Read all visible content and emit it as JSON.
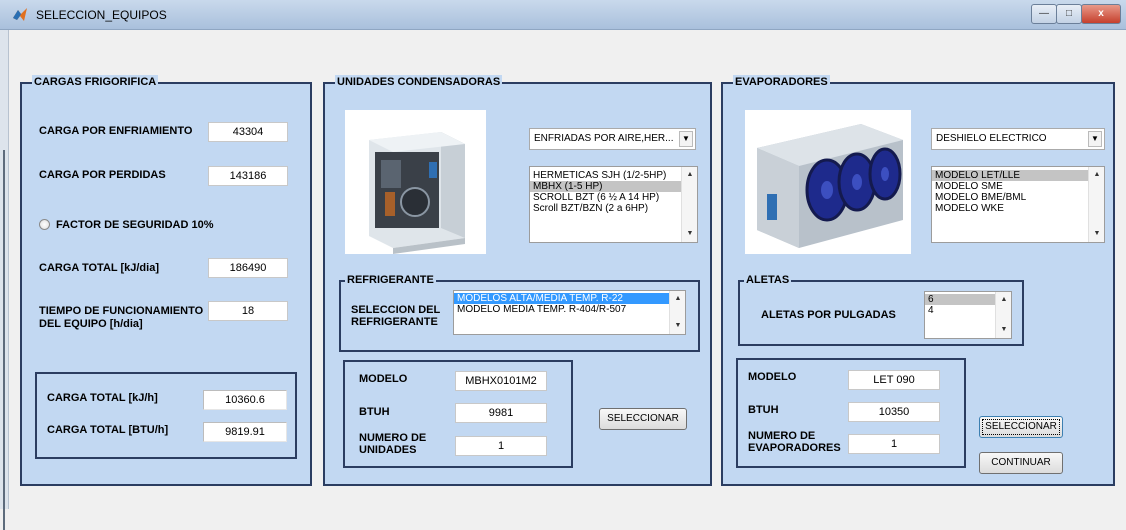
{
  "window": {
    "title": "SELECCION_EQUIPOS",
    "min_glyph": "—",
    "max_glyph": "□",
    "close_glyph": "x"
  },
  "cargas": {
    "title": "CARGAS FRIGORIFICA",
    "enfriamiento_label": "CARGA POR ENFRIAMIENTO",
    "enfriamiento_value": "43304",
    "perdidas_label": "CARGA POR PERDIDAS",
    "perdidas_value": "143186",
    "factor_label": "FACTOR DE SEGURIDAD 10%",
    "total_dia_label": "CARGA TOTAL [kJ/dia]",
    "total_dia_value": "186490",
    "tiempo_label_1": "TIEMPO DE FUNCIONAMIENTO",
    "tiempo_label_2": "DEL EQUIPO [h/dia]",
    "tiempo_value": "18",
    "total_kjh_label": "CARGA TOTAL [kJ/h]",
    "total_kjh_value": "10360.6",
    "total_btuh_label": "CARGA TOTAL [BTU/h]",
    "total_btuh_value": "9819.91"
  },
  "unidades": {
    "title": "UNIDADES CONDENSADORAS",
    "type_selected": "ENFRIADAS POR AIRE,HER...",
    "list": [
      "HERMETICAS SJH (1/2-5HP)",
      "MBHX (1-5 HP)",
      "SCROLL BZT (6 ½ A 14 HP)",
      "Scroll BZT/BZN (2 a 6HP)"
    ],
    "refrigerante_title": "REFRIGERANTE",
    "refrigerante_label_1": "SELECCION DEL",
    "refrigerante_label_2": "REFRIGERANTE",
    "refrigerante_list": [
      "MODELOS ALTA/MEDIA TEMP. R-22",
      "MODELO MEDIA TEMP. R-404/R-507"
    ],
    "modelo_label": "MODELO",
    "modelo_value": "MBHX0101M2",
    "btuh_label": "BTUH",
    "btuh_value": "9981",
    "numero_label_1": "NUMERO DE",
    "numero_label_2": "UNIDADES",
    "numero_value": "1",
    "select_button": "SELECCIONAR"
  },
  "evaporadores": {
    "title": "EVAPORADORES",
    "type_selected": "DESHIELO ELECTRICO",
    "list": [
      "MODELO LET/LLE",
      "MODELO SME",
      "MODELO BME/BML",
      "MODELO WKE"
    ],
    "aletas_title": "ALETAS",
    "aletas_label": "ALETAS POR PULGADAS",
    "aletas_list": [
      "6",
      "4"
    ],
    "modelo_label": "MODELO",
    "modelo_value": "LET 090",
    "btuh_label": "BTUH",
    "btuh_value": "10350",
    "numero_label_1": "NUMERO DE",
    "numero_label_2": "EVAPORADORES",
    "numero_value": "1",
    "select_button": "SELECCIONAR",
    "continue_button": "CONTINUAR"
  },
  "icons": {
    "app": "matlab-logo-icon",
    "dropdown": "chevron-down-icon",
    "scroll_up": "scroll-up-arrow-icon",
    "scroll_down": "scroll-down-arrow-icon"
  },
  "colors": {
    "panel_bg": "#c2d8f2",
    "panel_border": "#2b3d61",
    "list_selection_blue": "#3399ff",
    "list_selection_grey": "#c4c4c4"
  }
}
